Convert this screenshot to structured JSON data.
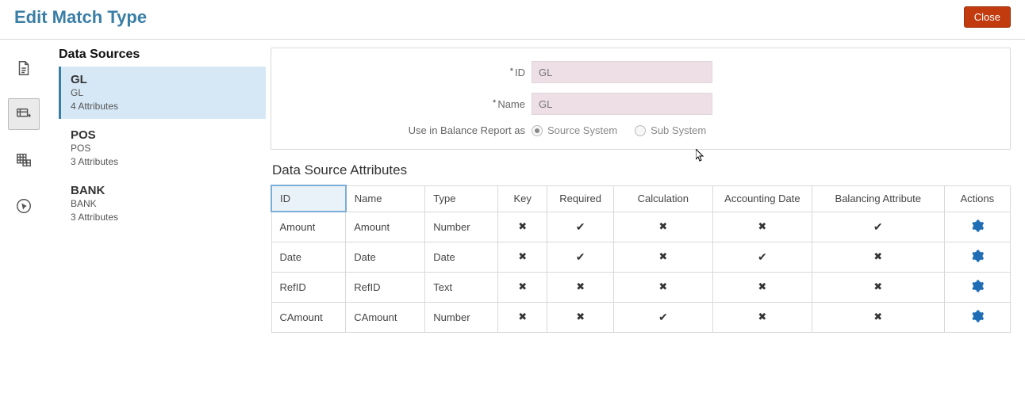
{
  "header": {
    "title": "Edit Match Type",
    "close_label": "Close"
  },
  "sidebar": {
    "heading": "Data Sources",
    "items": [
      {
        "title": "GL",
        "sub1": "GL",
        "sub2": "4 Attributes",
        "selected": true
      },
      {
        "title": "POS",
        "sub1": "POS",
        "sub2": "3 Attributes",
        "selected": false
      },
      {
        "title": "BANK",
        "sub1": "BANK",
        "sub2": "3 Attributes",
        "selected": false
      }
    ]
  },
  "form": {
    "id_label": "ID",
    "id_value": "GL",
    "name_label": "Name",
    "name_value": "GL",
    "balance_label": "Use in Balance Report as",
    "radio_source": "Source System",
    "radio_sub": "Sub System"
  },
  "attributes_section": {
    "heading": "Data Source Attributes",
    "columns": {
      "id": "ID",
      "name": "Name",
      "type": "Type",
      "key": "Key",
      "required": "Required",
      "calculation": "Calculation",
      "accounting_date": "Accounting Date",
      "balancing_attribute": "Balancing Attribute",
      "actions": "Actions"
    }
  },
  "chart_data": {
    "type": "table",
    "columns": [
      "ID",
      "Name",
      "Type",
      "Key",
      "Required",
      "Calculation",
      "Accounting Date",
      "Balancing Attribute"
    ],
    "rows": [
      {
        "ID": "Amount",
        "Name": "Amount",
        "Type": "Number",
        "Key": false,
        "Required": true,
        "Calculation": false,
        "Accounting Date": false,
        "Balancing Attribute": true
      },
      {
        "ID": "Date",
        "Name": "Date",
        "Type": "Date",
        "Key": false,
        "Required": true,
        "Calculation": false,
        "Accounting Date": true,
        "Balancing Attribute": false
      },
      {
        "ID": "RefID",
        "Name": "RefID",
        "Type": "Text",
        "Key": false,
        "Required": false,
        "Calculation": false,
        "Accounting Date": false,
        "Balancing Attribute": false
      },
      {
        "ID": "CAmount",
        "Name": "CAmount",
        "Type": "Number",
        "Key": false,
        "Required": false,
        "Calculation": true,
        "Accounting Date": false,
        "Balancing Attribute": false
      }
    ]
  }
}
